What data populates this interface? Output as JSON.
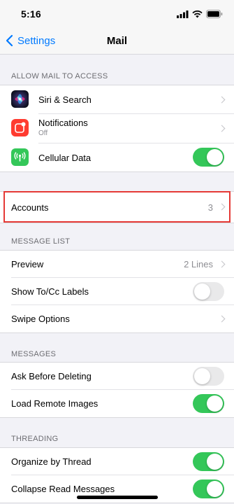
{
  "status_bar": {
    "time": "5:16"
  },
  "nav": {
    "back_label": "Settings",
    "title": "Mail"
  },
  "sections": {
    "allow_access": {
      "header": "ALLOW MAIL TO ACCESS",
      "siri": {
        "label": "Siri & Search"
      },
      "notifications": {
        "label": "Notifications",
        "sublabel": "Off"
      },
      "cellular": {
        "label": "Cellular Data",
        "toggle_on": true
      }
    },
    "accounts": {
      "label": "Accounts",
      "value": "3"
    },
    "message_list": {
      "header": "MESSAGE LIST",
      "preview": {
        "label": "Preview",
        "value": "2 Lines"
      },
      "show_tocc": {
        "label": "Show To/Cc Labels",
        "toggle_on": false
      },
      "swipe": {
        "label": "Swipe Options"
      }
    },
    "messages": {
      "header": "MESSAGES",
      "ask_before_deleting": {
        "label": "Ask Before Deleting",
        "toggle_on": false
      },
      "load_remote_images": {
        "label": "Load Remote Images",
        "toggle_on": true
      }
    },
    "threading": {
      "header": "THREADING",
      "organize_by_thread": {
        "label": "Organize by Thread",
        "toggle_on": true
      },
      "collapse_read": {
        "label": "Collapse Read Messages",
        "toggle_on": true
      }
    }
  },
  "colors": {
    "accent": "#007aff",
    "toggle_on": "#34c759",
    "toggle_off": "#e9e9ea",
    "highlight": "#e53935",
    "notifications_icon": "#ff3b30",
    "cellular_icon": "#34c759"
  },
  "icons": {
    "back": "chevron-left-icon",
    "siri": "siri-icon",
    "notifications": "notifications-icon",
    "cellular": "cellular-antenna-icon"
  }
}
